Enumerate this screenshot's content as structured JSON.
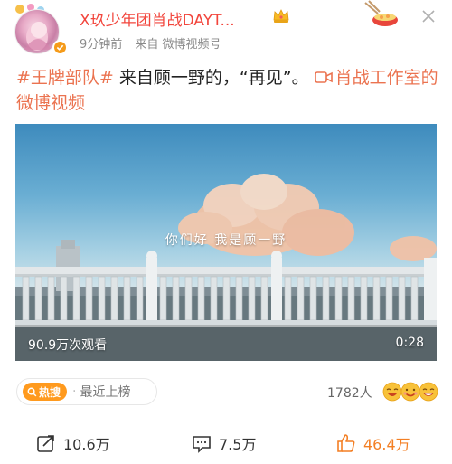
{
  "header": {
    "username": "X玖少年团肖战DAYT...",
    "time": "9分钟前",
    "source": "来自 微博视频号",
    "icons": {
      "verified": "verified-badge-icon",
      "crown": "crown-icon",
      "sticker": "sticker-icon",
      "close": "close-icon"
    }
  },
  "post": {
    "hashtag": "#王牌部队#",
    "text": " 来自顾一野的，“再见”。 ",
    "video_link": "肖战工作室的微博视频"
  },
  "video": {
    "subtitle": "你们好  我是顾一野",
    "views": "90.9万次观看",
    "duration": "0:28"
  },
  "hot": {
    "badge": "热搜",
    "label": "最近上榜"
  },
  "likers": {
    "count": "1782人"
  },
  "actions": {
    "forward": "10.6万",
    "comment": "7.5万",
    "like": "46.4万"
  },
  "colors": {
    "username": "#f2453c",
    "link": "#eb7350",
    "hot_badge": "#ff9a1e",
    "like": "#f37f24"
  }
}
